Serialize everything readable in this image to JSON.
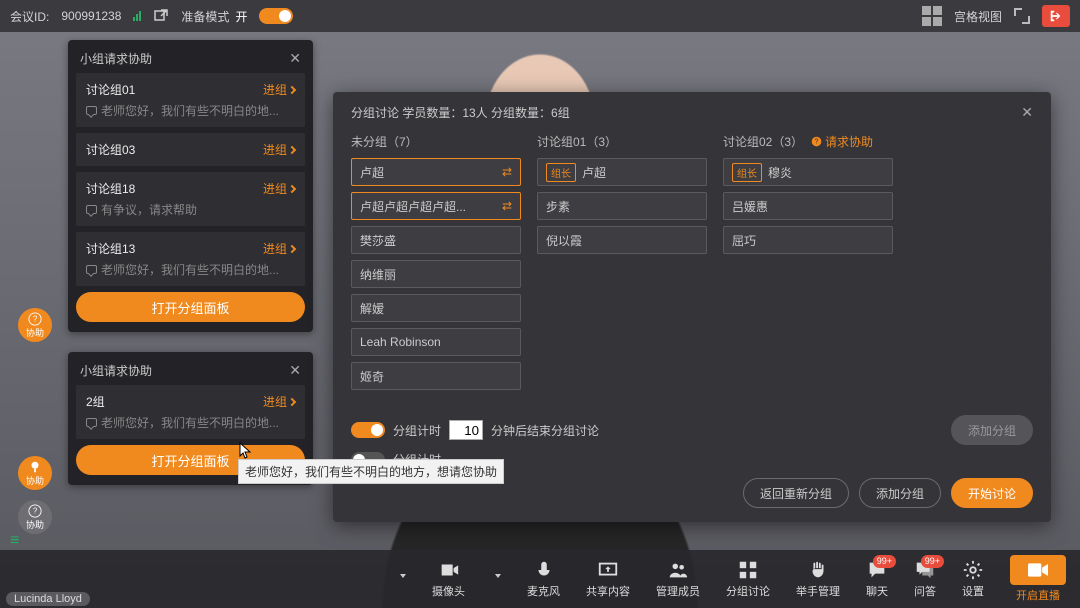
{
  "topbar": {
    "meeting_label": "会议ID:",
    "meeting_id": "900991238",
    "mode_label": "准备模式",
    "toggle_on": "开",
    "grid_view": "宫格视图"
  },
  "assist_bubble": "协助",
  "assist_panel": {
    "title": "小组请求协助",
    "enter": "进组",
    "open_btn": "打开分组面板",
    "msg1": "老师您好，我们有些不明白的地...",
    "msg2": "有争议，请求帮助",
    "items1": [
      {
        "name": "讨论组01",
        "msg": "msg1"
      },
      {
        "name": "讨论组03",
        "msg": null
      },
      {
        "name": "讨论组18",
        "msg": "msg2"
      },
      {
        "name": "讨论组13",
        "msg": "msg1"
      }
    ],
    "items2": [
      {
        "name": "2组",
        "msg": "msg1"
      }
    ]
  },
  "tooltip": "老师您好，我们有些不明白的地方，想请您协助",
  "modal": {
    "title": "分组讨论   学员数量：13人  分组数量：6组",
    "col_ungrouped": "未分组（7）",
    "col_g1": "讨论组01（3）",
    "col_g2": "讨论组02（3）",
    "help": "请求协助",
    "leader": "组长",
    "ungrouped": [
      "卢超",
      "卢超卢超卢超卢超...",
      "樊莎盛",
      "纳维丽",
      "解嫒",
      "Leah Robinson",
      "姬奇"
    ],
    "g1": [
      "卢超",
      "步素",
      "倪以霞"
    ],
    "g2": [
      "穆炎",
      "吕媛惠",
      "屈巧"
    ],
    "timer_label": "分组计时",
    "timer_value": "10",
    "timer_after": "分钟后结束分组讨论",
    "add_group_disabled": "添加分组",
    "btn_restart": "返回重新分组",
    "btn_add": "添加分组",
    "btn_start": "开始讨论"
  },
  "bottom": {
    "camera": "摄像头",
    "mic": "麦克风",
    "share": "共享内容",
    "members": "管理成员",
    "breakout": "分组讨论",
    "hand": "举手管理",
    "chat": "聊天",
    "qa": "问答",
    "settings": "设置",
    "live": "开启直播",
    "badge": "99+"
  },
  "username": "Lucinda Lloyd"
}
